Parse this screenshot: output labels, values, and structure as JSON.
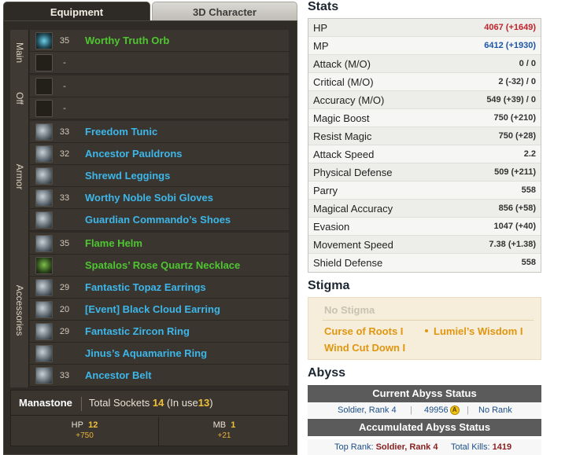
{
  "tabs": {
    "equipment": "Equipment",
    "character": "3D Character"
  },
  "groups": {
    "main": {
      "label": "Main",
      "items": [
        {
          "level": "35",
          "name": "Worthy Truth Orb",
          "quality": "green",
          "icon": "orb-icon"
        },
        {
          "level": "-",
          "name": "",
          "quality": "",
          "icon": "empty-slot"
        }
      ]
    },
    "off": {
      "label": "Off",
      "items": [
        {
          "level": "-",
          "name": "",
          "quality": "",
          "icon": "empty-slot"
        },
        {
          "level": "-",
          "name": "",
          "quality": "",
          "icon": "empty-slot"
        }
      ]
    },
    "armor": {
      "label": "Armor",
      "items": [
        {
          "level": "33",
          "name": "Freedom Tunic",
          "quality": "blue",
          "icon": "tunic-icon"
        },
        {
          "level": "32",
          "name": "Ancestor Pauldrons",
          "quality": "blue",
          "icon": "pauldrons-icon"
        },
        {
          "level": "",
          "name": "Shrewd Leggings",
          "quality": "blue",
          "icon": "leggings-icon"
        },
        {
          "level": "33",
          "name": "Worthy Noble Sobi Gloves",
          "quality": "blue",
          "icon": "gloves-icon"
        },
        {
          "level": "",
          "name": "Guardian Commando’s Shoes",
          "quality": "blue",
          "icon": "shoes-icon"
        }
      ]
    },
    "accessories": {
      "label": "Accessories",
      "items": [
        {
          "level": "35",
          "name": "Flame Helm",
          "quality": "green",
          "icon": "helm-icon"
        },
        {
          "level": "",
          "name": "Spatalos’ Rose Quartz Necklace",
          "quality": "green",
          "icon": "necklace-icon"
        },
        {
          "level": "29",
          "name": "Fantastic Topaz Earrings",
          "quality": "blue",
          "icon": "earring-icon"
        },
        {
          "level": "20",
          "name": "[Event] Black Cloud Earring",
          "quality": "blue",
          "icon": "earring-icon"
        },
        {
          "level": "29",
          "name": "Fantastic Zircon Ring",
          "quality": "blue",
          "icon": "ring-icon"
        },
        {
          "level": "",
          "name": "Jinus’s Aquamarine Ring",
          "quality": "blue",
          "icon": "ring-icon"
        },
        {
          "level": "33",
          "name": "Ancestor Belt",
          "quality": "blue",
          "icon": "belt-icon"
        }
      ]
    }
  },
  "manastone": {
    "title": "Manastone",
    "sockets_label": "Total Sockets",
    "sockets": "14",
    "in_use_label_open": "(In use",
    "in_use": "13",
    "in_use_label_close": ")",
    "hp_label": "HP",
    "hp_count": "12",
    "hp_bonus": "+750",
    "mb_label": "MB",
    "mb_count": "1",
    "mb_bonus": "+21"
  },
  "stats": {
    "title": "Stats",
    "rows": [
      {
        "name": "HP",
        "value": "4067 (+1649)",
        "color": "#c0232a"
      },
      {
        "name": "MP",
        "value": "6412 (+1930)",
        "color": "#1d55a8"
      },
      {
        "name": "Attack (M/O)",
        "value": "0 / 0"
      },
      {
        "name": "Critical (M/O)",
        "value": "2 (-32) / 0"
      },
      {
        "name": "Accuracy (M/O)",
        "value": "549 (+39) / 0"
      },
      {
        "name": "Magic Boost",
        "value": "750 (+210)"
      },
      {
        "name": "Resist Magic",
        "value": "750 (+28)"
      },
      {
        "name": "Attack Speed",
        "value": "2.2"
      },
      {
        "name": "Physical Defense",
        "value": "509 (+211)"
      },
      {
        "name": "Parry",
        "value": "558"
      },
      {
        "name": "Magical Accuracy",
        "value": "856 (+58)"
      },
      {
        "name": "Evasion",
        "value": "1047 (+40)"
      },
      {
        "name": "Movement Speed",
        "value": "7.38 (+1.38)"
      },
      {
        "name": "Shield Defense",
        "value": "558"
      }
    ]
  },
  "stigma": {
    "title": "Stigma",
    "none": "No Stigma",
    "skills": [
      "Curse of Roots I",
      "Lumiel’s Wisdom I",
      "Wind Cut Down I"
    ]
  },
  "abyss": {
    "title": "Abyss",
    "current_title": "Current Abyss Status",
    "current_rank": "Soldier, Rank 4",
    "current_points": "49956",
    "coin": "A",
    "current_sep": "|",
    "current_ranking": "No Rank",
    "accumulated_title": "Accumulated Abyss Status",
    "top_rank_label": "Top Rank:",
    "top_rank": "Soldier, Rank 4",
    "kills_label": "Total Kills:",
    "kills": "1419"
  }
}
